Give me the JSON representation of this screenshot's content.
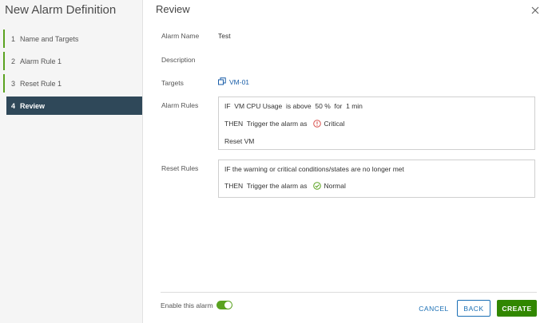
{
  "wizard": {
    "title": "New Alarm Definition",
    "steps": [
      {
        "num": "1",
        "label": "Name and Targets"
      },
      {
        "num": "2",
        "label": "Alarm Rule 1"
      },
      {
        "num": "3",
        "label": "Reset Rule 1"
      },
      {
        "num": "4",
        "label": "Review"
      }
    ],
    "active_step": 4
  },
  "review": {
    "title": "Review",
    "alarm_name_label": "Alarm Name",
    "alarm_name_value": "Test",
    "description_label": "Description",
    "description_value": "",
    "targets_label": "Targets",
    "targets_value": "VM-01",
    "alarm_rules_label": "Alarm Rules",
    "alarm_rules": {
      "condition": "IF  VM CPU Usage  is above  50 %  for  1 min",
      "then_text": "THEN  Trigger the alarm as",
      "severity": "Critical",
      "action": "Reset VM"
    },
    "reset_rules_label": "Reset Rules",
    "reset_rules": {
      "condition": "IF the warning or critical conditions/states are no longer met",
      "then_text": "THEN  Trigger the alarm as",
      "severity": "Normal"
    }
  },
  "footer": {
    "enable_label": "Enable this alarm",
    "enabled": true,
    "cancel_label": "CANCEL",
    "back_label": "BACK",
    "create_label": "CREATE"
  },
  "icons": {
    "close": "close-icon",
    "vm": "vm-icon",
    "critical": "critical-icon",
    "normal": "normal-icon"
  },
  "colors": {
    "accent_green": "#5aa220",
    "create_button": "#318700",
    "link_blue": "#1a6fb5",
    "active_step_bg": "#2f4859",
    "critical_red": "#d9534f",
    "normal_green": "#5aa220"
  }
}
